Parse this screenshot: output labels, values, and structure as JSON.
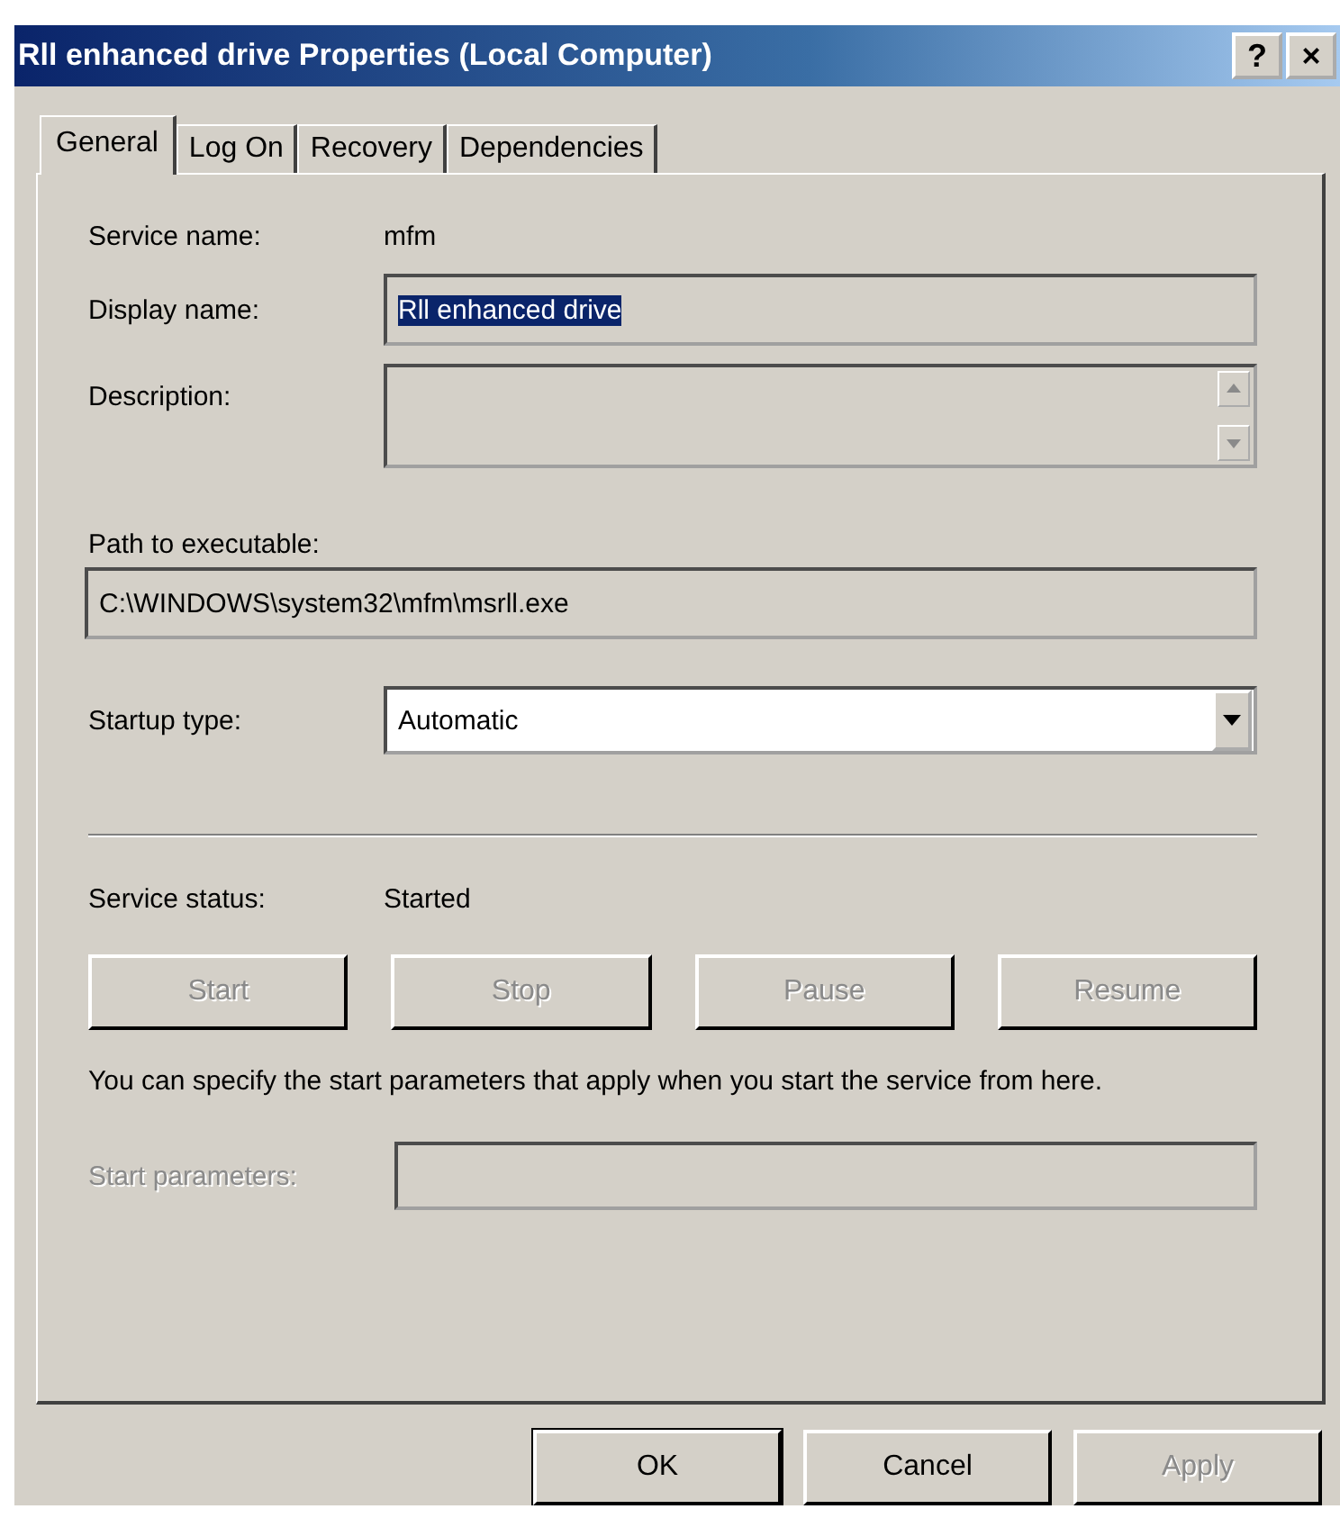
{
  "window": {
    "title": "Rll enhanced drive Properties (Local Computer)",
    "help_button": "?",
    "close_button": "×"
  },
  "tabs": [
    {
      "label": "General",
      "selected": true
    },
    {
      "label": "Log On",
      "selected": false
    },
    {
      "label": "Recovery",
      "selected": false
    },
    {
      "label": "Dependencies",
      "selected": false
    }
  ],
  "service_name": {
    "label": "Service name:",
    "value": "mfm"
  },
  "display_name": {
    "label": "Display name:",
    "value": "Rll enhanced drive",
    "text_selected": true
  },
  "description": {
    "label": "Description:"
  },
  "path": {
    "label": "Path to executable:",
    "value": "C:\\WINDOWS\\system32\\mfm\\msrll.exe"
  },
  "startup_type": {
    "label": "Startup type:",
    "value": "Automatic"
  },
  "service_status": {
    "label": "Service status:",
    "value": "Started"
  },
  "service_buttons": [
    {
      "label": "Start",
      "disabled": true
    },
    {
      "label": "Stop",
      "disabled": true
    },
    {
      "label": "Pause",
      "disabled": true
    },
    {
      "label": "Resume",
      "disabled": true
    }
  ],
  "info_text": "You can specify the start parameters that apply when you start the service from here.",
  "start_parameters": {
    "label": "Start parameters:",
    "disabled": true
  },
  "footer_buttons": [
    {
      "label": "OK",
      "disabled": false,
      "default": true
    },
    {
      "label": "Cancel",
      "disabled": false,
      "default": false
    },
    {
      "label": "Apply",
      "disabled": true,
      "default": false
    }
  ]
}
